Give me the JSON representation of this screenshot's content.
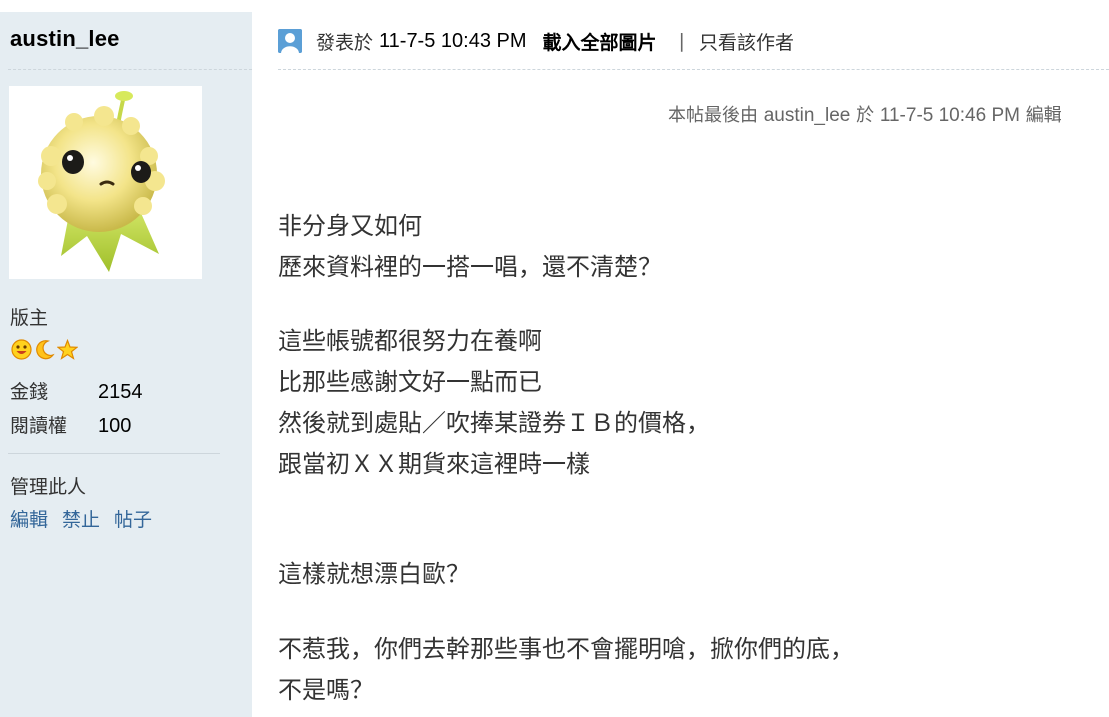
{
  "author": {
    "username": "austin_lee",
    "role": "版主",
    "medals": [
      "smiley-icon",
      "moon-icon",
      "star-icon"
    ],
    "stats": [
      {
        "label": "金錢",
        "value": "2154"
      },
      {
        "label": "閱讀權",
        "value": "100"
      }
    ],
    "manage_label": "管理此人",
    "manage_links": [
      "編輯",
      "禁止",
      "帖子"
    ]
  },
  "post": {
    "posted_prefix": "發表於",
    "posted_time": "11-7-5 10:43 PM",
    "download_all": "載入全部圖片",
    "separator": "|",
    "only_author": "只看該作者",
    "edit_note": {
      "prefix": "本帖最後由",
      "user": "austin_lee",
      "mid": "於",
      "time": "11-7-5 10:46 PM",
      "suffix": "編輯"
    },
    "paragraphs": [
      [
        "非分身又如何",
        "歷來資料裡的一搭一唱，還不清楚？"
      ],
      [
        "這些帳號都很努力在養啊",
        "比那些感謝文好一點而已",
        "然後就到處貼／吹捧某證券ＩＢ的價格，",
        "跟當初ＸＸ期貨來這裡時一樣"
      ],
      [
        "這樣就想漂白歐？"
      ],
      [
        "不惹我，你們去幹那些事也不會擺明嗆，掀你們的底，",
        "不是嗎？"
      ]
    ]
  }
}
